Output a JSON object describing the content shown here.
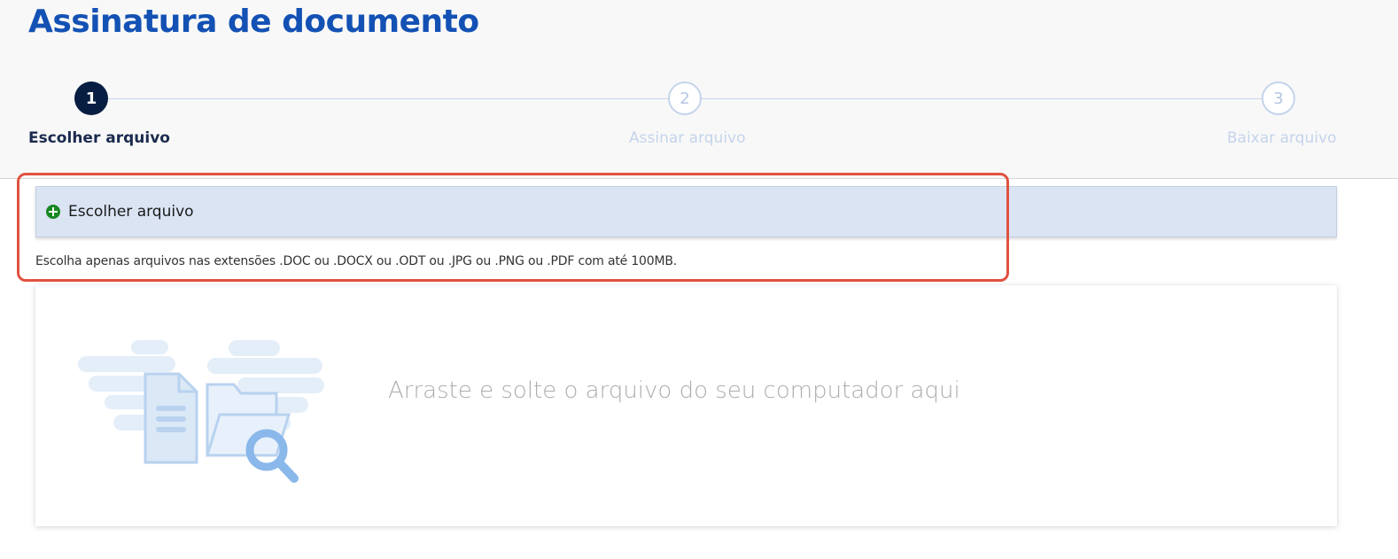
{
  "page": {
    "title": "Assinatura de documento"
  },
  "stepper": {
    "steps": [
      {
        "number": "1",
        "label": "Escolher arquivo",
        "state": "active"
      },
      {
        "number": "2",
        "label": "Assinar arquivo",
        "state": "inactive"
      },
      {
        "number": "3",
        "label": "Baixar arquivo",
        "state": "inactive"
      }
    ]
  },
  "upload": {
    "button_label": "Escolher arquivo",
    "button_icon": "plus-circle-icon",
    "hint": "Escolha apenas arquivos nas extensões .DOC ou .DOCX ou .ODT ou .JPG ou .PNG ou .PDF com até 100MB.",
    "drop_text": "Arraste e solte o arquivo do seu computador aqui",
    "illustration_icon": "file-folder-search-icon"
  },
  "colors": {
    "title": "#1351b4",
    "step_active": "#071d41",
    "step_inactive": "#c5d4eb",
    "button_bg": "#dbe4f3",
    "plus_icon": "#168821",
    "highlight": "#e05240"
  }
}
